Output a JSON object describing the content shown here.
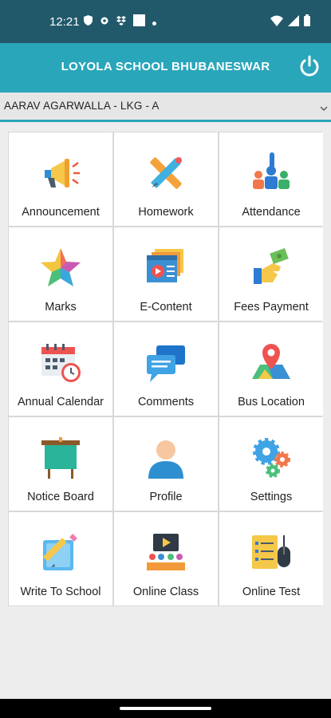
{
  "status_bar": {
    "time": "12:21",
    "left_icons": [
      "shield-icon",
      "gear-icon",
      "dropbox-icon",
      "square-icon",
      "dot-icon"
    ],
    "right_icons": [
      "wifi-icon",
      "signal-icon",
      "battery-icon"
    ]
  },
  "app_bar": {
    "title": "LOYOLA SCHOOL BHUBANESWAR",
    "power_icon": "power-icon"
  },
  "student_selector": {
    "value": "AARAV AGARWALLA - LKG - A"
  },
  "menu": {
    "items": [
      {
        "label": "Announcement",
        "icon": "megaphone-icon"
      },
      {
        "label": "Homework",
        "icon": "pencil-ruler-icon"
      },
      {
        "label": "Attendance",
        "icon": "people-raise-hand-icon"
      },
      {
        "label": "Marks",
        "icon": "star-icon"
      },
      {
        "label": "E-Content",
        "icon": "video-screens-icon"
      },
      {
        "label": "Fees Payment",
        "icon": "hand-money-icon"
      },
      {
        "label": "Annual Calendar",
        "icon": "calendar-clock-icon"
      },
      {
        "label": "Comments",
        "icon": "chat-bubbles-icon"
      },
      {
        "label": "Bus Location",
        "icon": "map-pin-icon"
      },
      {
        "label": "Notice Board",
        "icon": "notice-board-icon"
      },
      {
        "label": "Profile",
        "icon": "user-avatar-icon"
      },
      {
        "label": "Settings",
        "icon": "gears-icon"
      },
      {
        "label": "Write To School",
        "icon": "write-note-icon"
      },
      {
        "label": "Online Class",
        "icon": "video-class-icon"
      },
      {
        "label": "Online Test",
        "icon": "test-mouse-icon"
      }
    ]
  },
  "colors": {
    "status_bar": "#21596a",
    "app_bar": "#2aa6ba",
    "background": "#ededed"
  }
}
